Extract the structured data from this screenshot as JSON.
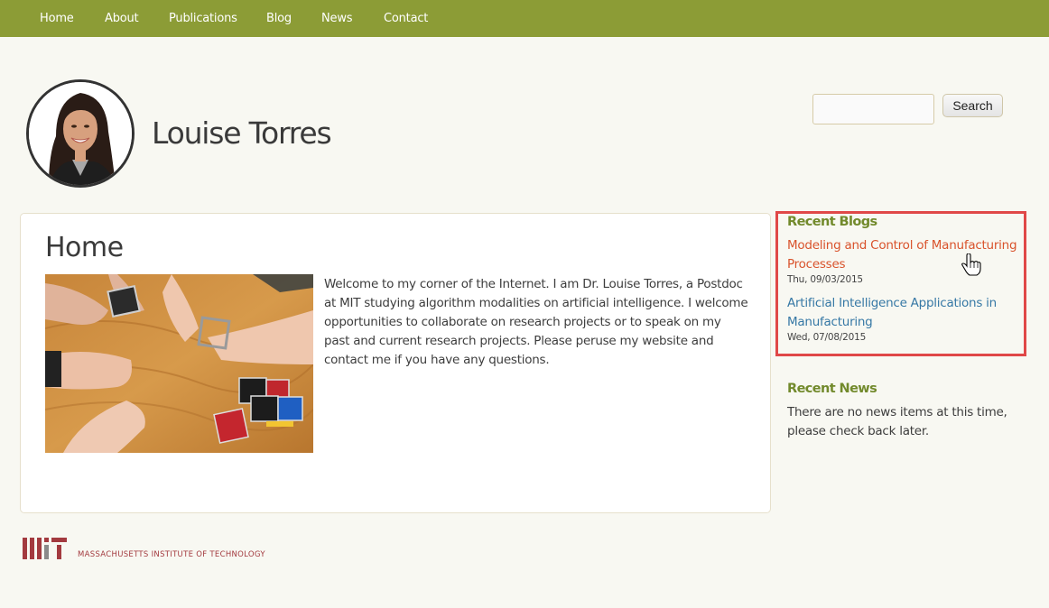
{
  "nav": {
    "items": [
      {
        "label": "Home"
      },
      {
        "label": "About"
      },
      {
        "label": "Publications"
      },
      {
        "label": "Blog"
      },
      {
        "label": "News"
      },
      {
        "label": "Contact"
      }
    ]
  },
  "header": {
    "site_name": "Louise Torres",
    "avatar_alt": "Portrait of Louise Torres"
  },
  "search": {
    "input_value": "",
    "button_label": "Search"
  },
  "main": {
    "title": "Home",
    "image_alt": "Hands assembling modular robotic cubes on a wooden table",
    "intro": "Welcome to my corner of the Internet. I am Dr. Louise Torres, a Postdoc at MIT studying algorithm modalities on artificial intelligence. I welcome opportunities to collaborate on research projects or to speak on my past and current research projects. Please peruse my website and contact me if you have any questions."
  },
  "sidebar": {
    "recent_blogs": {
      "title": "Recent Blogs",
      "items": [
        {
          "title": "Modeling and Control of Manufacturing Processes",
          "date": "Thu, 09/03/2015",
          "state": "hover"
        },
        {
          "title": "Artificial Intelligence Applications in Manufacturing",
          "date": "Wed, 07/08/2015",
          "state": "normal"
        }
      ]
    },
    "recent_news": {
      "title": "Recent News",
      "text": "There are no news items at this time, please check back later."
    }
  },
  "footer": {
    "logo_text": "MASSACHUSETTS INSTITUTE OF TECHNOLOGY"
  },
  "colors": {
    "nav_bg": "#8c9c36",
    "accent_green": "#728a2c",
    "link_hover": "#d9532c",
    "link": "#3678a5",
    "highlight_border": "#e04848",
    "mit_red": "#a33a3f"
  }
}
